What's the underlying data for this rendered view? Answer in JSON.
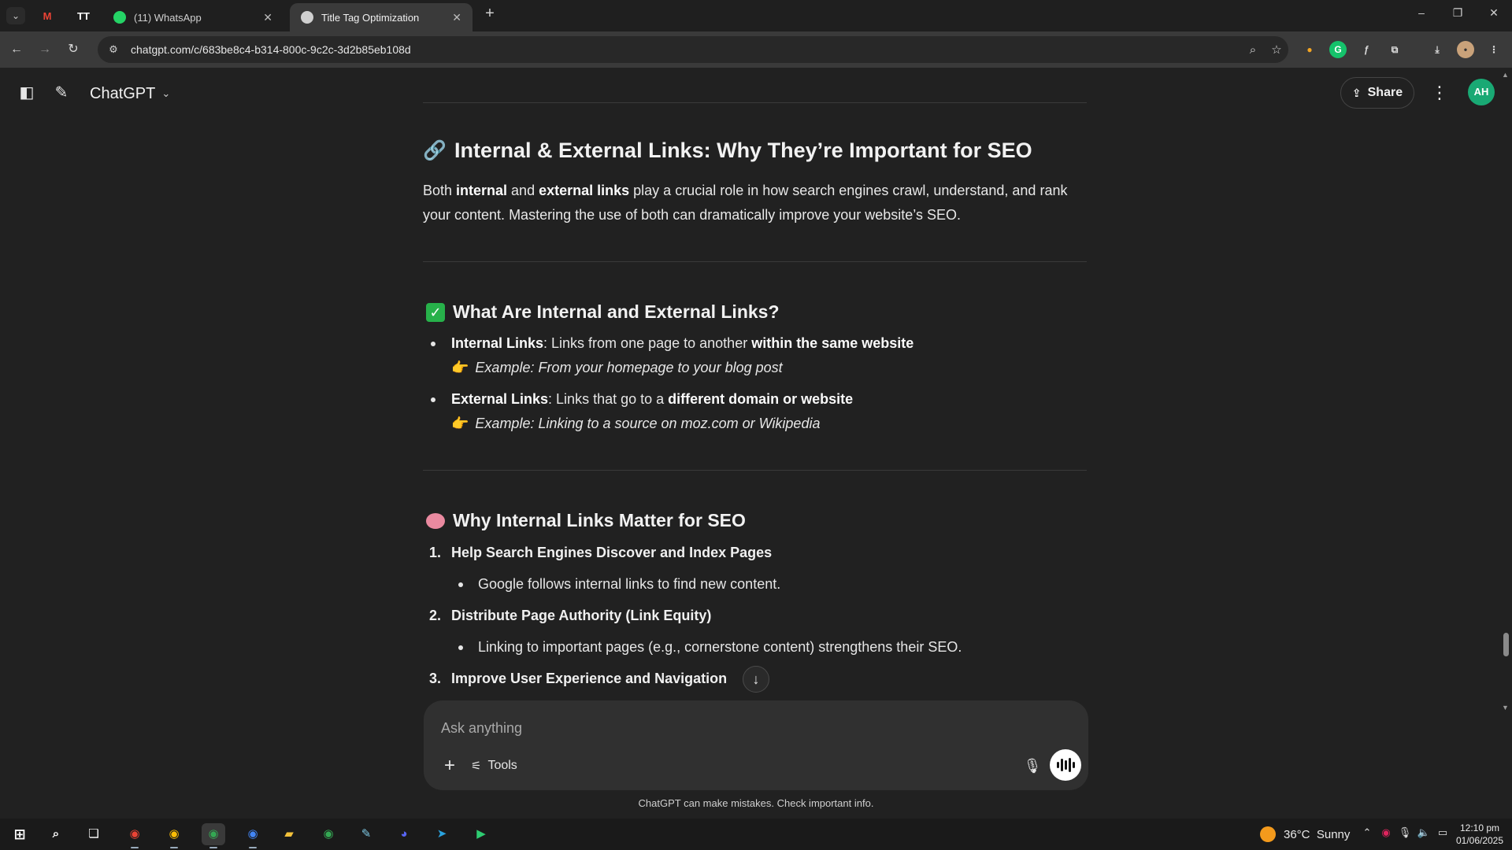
{
  "browser": {
    "tabs": [
      {
        "title": "(11) WhatsApp",
        "favicon": "whatsapp-icon",
        "active": false
      },
      {
        "title": "Title Tag Optimization",
        "favicon": "chatgpt-icon",
        "active": true
      }
    ],
    "pinned": [
      {
        "label": "M",
        "color": "#ea4335"
      },
      {
        "label": "TT",
        "color": "#ffffff"
      }
    ],
    "new_tab": "+",
    "url": "chatgpt.com/c/683be8c4-b314-800c-9c2c-3d2b85eb108d",
    "window": {
      "minimize": "–",
      "restore": "❐",
      "close": "✕"
    }
  },
  "app": {
    "model_name": "ChatGPT",
    "share_label": "Share",
    "avatar_initials": "AH",
    "accent": "#19a974"
  },
  "article": {
    "heading": "Internal & External Links: Why They’re Important for SEO",
    "intro": {
      "t1": "Both ",
      "b1": "internal",
      "t2": " and ",
      "b2": "external links",
      "t3": " play a crucial role in how search engines crawl, understand, and rank your content. Mastering the use of both can dramatically improve your website’s SEO."
    },
    "section1": {
      "title": "What Are Internal and External Links?",
      "items": [
        {
          "label": "Internal Links",
          "text": ": Links from one page to another ",
          "bold_tail": "within the same website",
          "example": "Example: From your homepage to your blog post"
        },
        {
          "label": "External Links",
          "text": ": Links that go to a ",
          "bold_tail": "different domain or website",
          "example": "Example: Linking to a source on moz.com or Wikipedia"
        }
      ]
    },
    "section2": {
      "title": "Why Internal Links Matter for SEO",
      "items": [
        {
          "num": "1.",
          "title": "Help Search Engines Discover and Index Pages",
          "sub": "Google follows internal links to find new content."
        },
        {
          "num": "2.",
          "title": "Distribute Page Authority (Link Equity)",
          "sub": "Linking to important pages (e.g., cornerstone content) strengthens their SEO."
        },
        {
          "num": "3.",
          "title": "Improve User Experience and Navigation",
          "sub": ""
        }
      ]
    }
  },
  "composer": {
    "placeholder": "Ask anything",
    "tools_label": "Tools",
    "disclaimer": "ChatGPT can make mistakes. Check important info."
  },
  "taskbar": {
    "weather_temp": "36°C",
    "weather_text": "Sunny",
    "time": "12:10 pm",
    "date": "01/06/2025"
  }
}
